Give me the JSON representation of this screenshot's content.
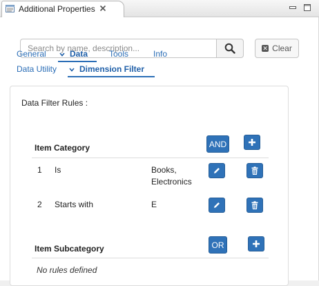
{
  "view": {
    "title": "Additional Properties",
    "icon": "properties-view-icon",
    "close_icon": "close-icon",
    "minimize_icon": "minimize-icon",
    "maximize_icon": "maximize-icon"
  },
  "search": {
    "placeholder": "Search by name, description...",
    "value": "",
    "button_icon": "search-icon",
    "clear_label": "Clear"
  },
  "tabs_row1": [
    {
      "label": "General",
      "active": false
    },
    {
      "label": "Data",
      "active": true
    },
    {
      "label": "Tools",
      "active": false
    },
    {
      "label": "Info",
      "active": false
    }
  ],
  "tabs_row2": [
    {
      "label": "Data Utility",
      "active": false
    },
    {
      "label": "Dimension Filter",
      "active": true
    }
  ],
  "filter": {
    "heading": "Data Filter Rules :",
    "groups": [
      {
        "name": "Item Category",
        "operator": "AND",
        "rules": [
          {
            "index": "1",
            "condition": "Is",
            "value_lines": [
              "Books,",
              "Electronics"
            ]
          },
          {
            "index": "2",
            "condition": "Starts with",
            "value_lines": [
              "E"
            ]
          }
        ]
      },
      {
        "name": "Item Subcategory",
        "operator": "OR",
        "empty_text": "No rules defined"
      }
    ]
  },
  "colors": {
    "accent": "#2f72b8",
    "link": "#2a6db6"
  }
}
